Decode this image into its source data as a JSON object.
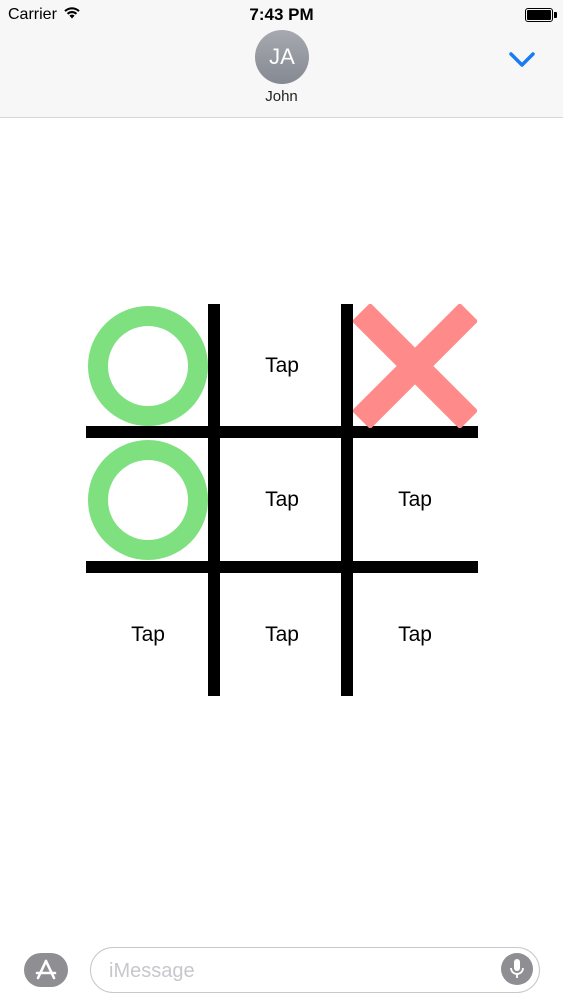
{
  "status_bar": {
    "carrier": "Carrier",
    "time": "7:43 PM",
    "wifi_icon": "wifi-icon",
    "battery_icon": "battery-full-icon"
  },
  "header": {
    "avatar_initials": "JA",
    "contact_name": "John",
    "collapse_icon": "chevron-down-icon"
  },
  "colors": {
    "o_mark": "#7fe07f",
    "x_mark": "#ff8a8a",
    "accent": "#1a7cf2",
    "grid": "#000000"
  },
  "board": {
    "cells": [
      {
        "mark": "O",
        "label": ""
      },
      {
        "mark": "",
        "label": "Tap"
      },
      {
        "mark": "X",
        "label": ""
      },
      {
        "mark": "O",
        "label": ""
      },
      {
        "mark": "",
        "label": "Tap"
      },
      {
        "mark": "",
        "label": "Tap"
      },
      {
        "mark": "",
        "label": "Tap"
      },
      {
        "mark": "",
        "label": "Tap"
      },
      {
        "mark": "",
        "label": "Tap"
      }
    ]
  },
  "input_bar": {
    "app_store_icon": "app-store-icon",
    "placeholder": "iMessage",
    "mic_icon": "microphone-icon"
  }
}
